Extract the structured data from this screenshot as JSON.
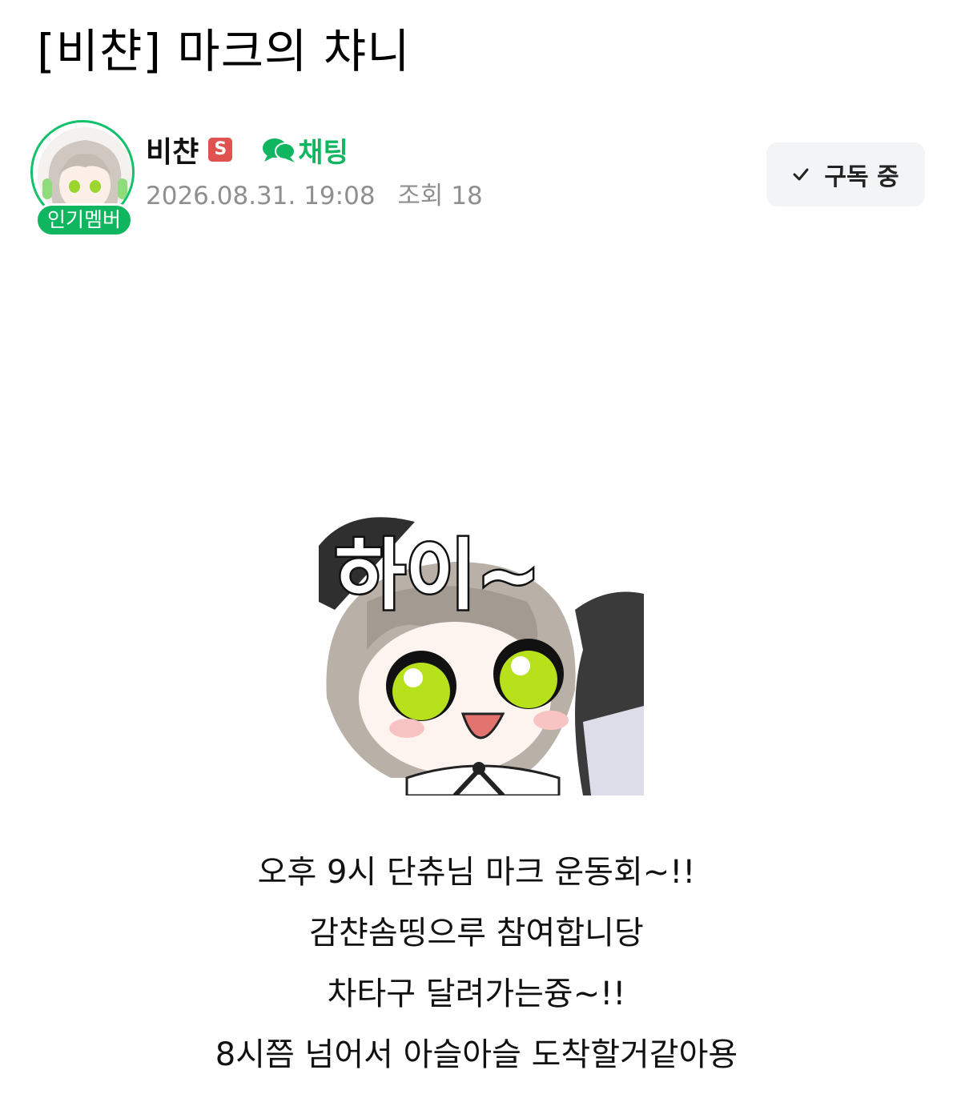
{
  "post": {
    "title": "[비챤] 마크의 챠니",
    "author": {
      "name": "비챤",
      "staff_badge": "S",
      "popular_badge": "인기멤버",
      "chat_label": "채팅"
    },
    "meta": {
      "datetime": "2026.08.31. 19:08",
      "views_label": "조회",
      "views": "18"
    },
    "subscribe_label": "구독 중",
    "sticker_text": "하이~",
    "body_lines": [
      "오후 9시 단츄님 마크 운동회~!!",
      "감챤솜띵으루 참여합니당",
      "차타구 달려가는즁~!!",
      "8시쯤 넘어서 아슬아슬 도착할거같아용"
    ]
  },
  "colors": {
    "brand_green": "#10b55f",
    "staff_red": "#e0524f",
    "meta_gray": "#8f8f8f",
    "button_bg": "#f3f4f6"
  },
  "icons": [
    "avatar-image",
    "staff-badge-icon",
    "chat-bubble-icon",
    "check-icon",
    "sticker-image"
  ]
}
